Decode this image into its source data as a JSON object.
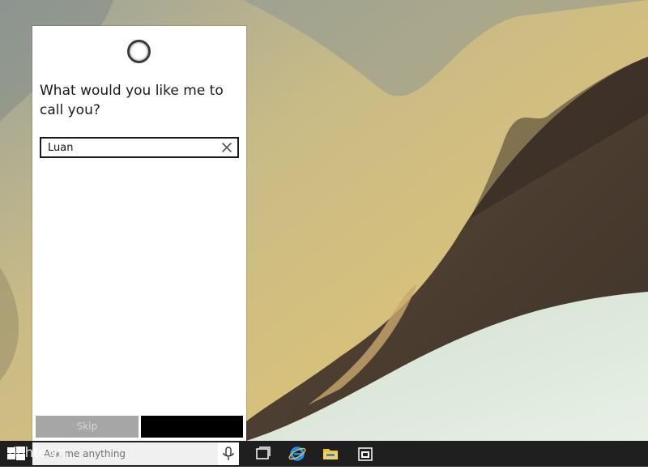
{
  "cortana": {
    "question": "What would you like me to call you?",
    "name_value": "Luan",
    "skip_label": "Skip",
    "next_label": ""
  },
  "taskbar": {
    "search_placeholder": "Ask me anything",
    "icons": [
      "windows-start-icon",
      "microphone-icon",
      "task-view-icon",
      "internet-explorer-icon",
      "file-explorer-icon",
      "store-icon"
    ]
  },
  "watermark": "tinhte.vn",
  "colors": {
    "panel_bg": "#ffffff",
    "skip_bg": "#a6a6a6",
    "next_bg": "#000000",
    "taskbar_bg": "#1f1f1f",
    "ie_blue": "#1e90ff",
    "folder_yellow": "#f4c430"
  }
}
